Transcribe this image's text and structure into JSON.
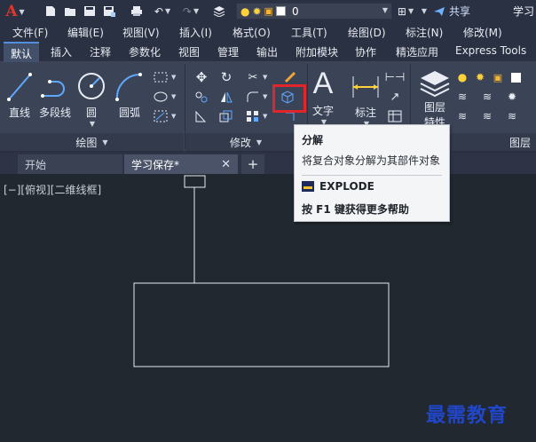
{
  "quick_access": {
    "layer_value": "0",
    "share_label": "共享",
    "app_title": "学习"
  },
  "menu": [
    "文件(F)",
    "编辑(E)",
    "视图(V)",
    "插入(I)",
    "格式(O)",
    "工具(T)",
    "绘图(D)",
    "标注(N)",
    "修改(M)"
  ],
  "ribbon_tabs": [
    "默认",
    "插入",
    "注释",
    "参数化",
    "视图",
    "管理",
    "输出",
    "附加模块",
    "协作",
    "精选应用",
    "Express Tools"
  ],
  "active_ribbon_tab": "默认",
  "draw_panel": {
    "buttons": [
      "直线",
      "多段线",
      "圆",
      "圆弧"
    ],
    "footer": "绘图"
  },
  "modify_panel": {
    "footer": "修改"
  },
  "annotation_panel": {
    "buttons": [
      "文字",
      "标注"
    ]
  },
  "layers_panel": {
    "button_line1": "图层",
    "button_line2": "特性",
    "footer": "图层"
  },
  "tooltip": {
    "title": "分解",
    "description": "将复合对象分解为其部件对象",
    "command": "EXPLODE",
    "help": "按 F1 键获得更多帮助"
  },
  "doc_tabs": {
    "home": "开始",
    "drawing": "学习保存*",
    "close_glyph": "✕",
    "add_glyph": "+"
  },
  "canvas": {
    "viewport_label": "[−][俯视][二维线框]"
  },
  "watermark": "最需教育",
  "colors": {
    "background": "#212830",
    "ribbon": "#3b4457",
    "highlight": "#e0262a",
    "accent": "#4f8fdd",
    "watermark": "#2146c8"
  }
}
